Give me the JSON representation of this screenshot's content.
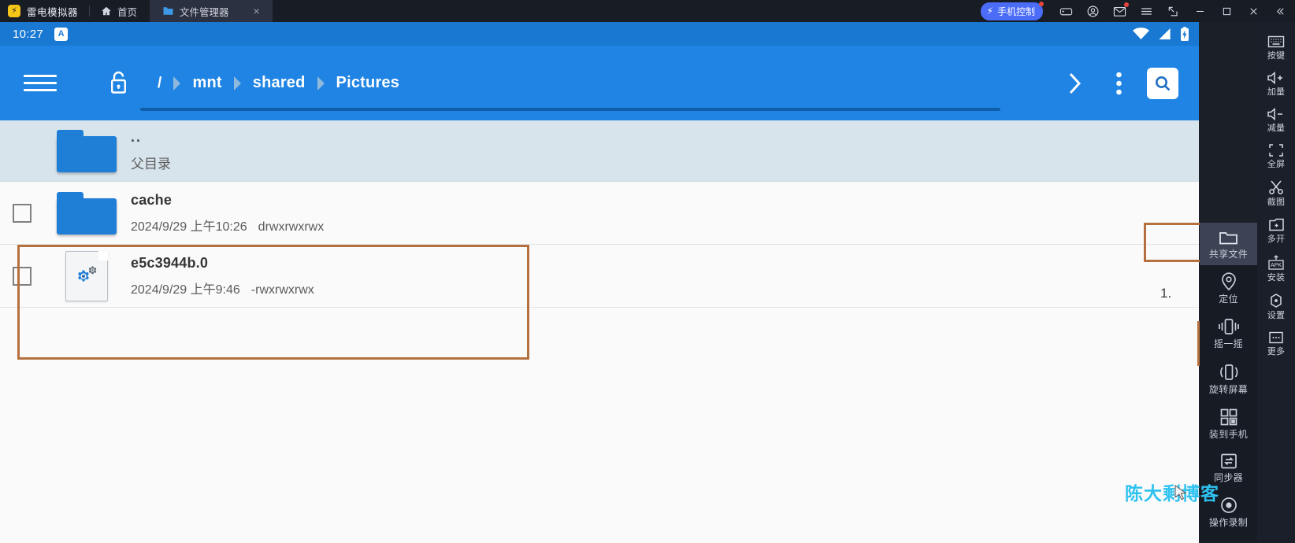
{
  "window": {
    "brand_logo": "ld-logo-icon",
    "brand_name": "雷电模拟器",
    "tabs": [
      {
        "label": "首页",
        "icon": "home-icon",
        "active": false
      },
      {
        "label": "文件管理器",
        "icon": "folder-icon",
        "active": true,
        "close": "×"
      }
    ],
    "phone_control_label": "手机控制",
    "controls": [
      {
        "name": "gamepad-icon"
      },
      {
        "name": "account-icon"
      },
      {
        "name": "mail-icon"
      },
      {
        "name": "menu-icon"
      },
      {
        "name": "restore-window-icon"
      },
      {
        "name": "minimize-icon"
      },
      {
        "name": "maximize-icon"
      },
      {
        "name": "close-icon"
      },
      {
        "name": "collapse-icon"
      }
    ]
  },
  "status_bar": {
    "time": "10:27",
    "input_badge": "A",
    "icons": [
      "wifi-icon",
      "signal-icon",
      "battery-charging-icon"
    ]
  },
  "app_bar": {
    "menu_icon": "hamburger-icon",
    "lock_icon": "unlocked-lock-icon",
    "breadcrumbs": [
      "/",
      "mnt",
      "shared",
      "Pictures"
    ],
    "forward_icon": "chevron-right-icon",
    "overflow_icon": "more-vertical-icon",
    "search_icon": "search-icon"
  },
  "file_list": {
    "parent": {
      "name": "..",
      "subtitle": "父目录",
      "icon": "folder-icon"
    },
    "items": [
      {
        "name": "cache",
        "date": "2024/9/29 上午10:26",
        "permissions": "drwxrwxrwx",
        "icon": "folder-icon",
        "type": "folder",
        "checked": false
      },
      {
        "name": "e5c3944b.0",
        "date": "2024/9/29 上午9:46",
        "permissions": "-rwxrwxrwx",
        "icon": "config-file-icon",
        "type": "file",
        "checked": false
      }
    ]
  },
  "annotations": {
    "step_number": "1.",
    "watermark": "陈大剩博客",
    "highlight_color": "#b5703f"
  },
  "popup_menu": {
    "items": [
      {
        "label": "共享文件",
        "icon": "shared-folder-icon",
        "active": true
      },
      {
        "label": "定位",
        "icon": "location-pin-icon",
        "active": false
      },
      {
        "label": "摇一摇",
        "icon": "shake-icon",
        "active": false
      },
      {
        "label": "旋转屏幕",
        "icon": "rotate-screen-icon",
        "active": false
      },
      {
        "label": "装到手机",
        "icon": "qr-code-icon",
        "active": false
      },
      {
        "label": "同步器",
        "icon": "sync-icon",
        "active": false
      },
      {
        "label": "操作录制",
        "icon": "record-icon",
        "active": false
      }
    ]
  },
  "sidebar": {
    "items": [
      {
        "label": "按键",
        "icon": "keyboard-icon"
      },
      {
        "label": "加量",
        "icon": "volume-up-icon"
      },
      {
        "label": "减量",
        "icon": "volume-down-icon"
      },
      {
        "label": "全屏",
        "icon": "fullscreen-icon"
      },
      {
        "label": "截图",
        "icon": "scissors-icon"
      },
      {
        "label": "多开",
        "icon": "multi-instance-icon"
      },
      {
        "label": "安装",
        "icon": "apk-install-icon"
      },
      {
        "label": "设置",
        "icon": "settings-icon"
      },
      {
        "label": "更多",
        "icon": "more-dots-icon"
      }
    ]
  },
  "colors": {
    "accent_blue": "#1f84e3",
    "status_blue": "#1878d2",
    "titlebar": "#181c24",
    "sidebar": "#1b1f2a",
    "watermark": "#2ec2f0"
  }
}
